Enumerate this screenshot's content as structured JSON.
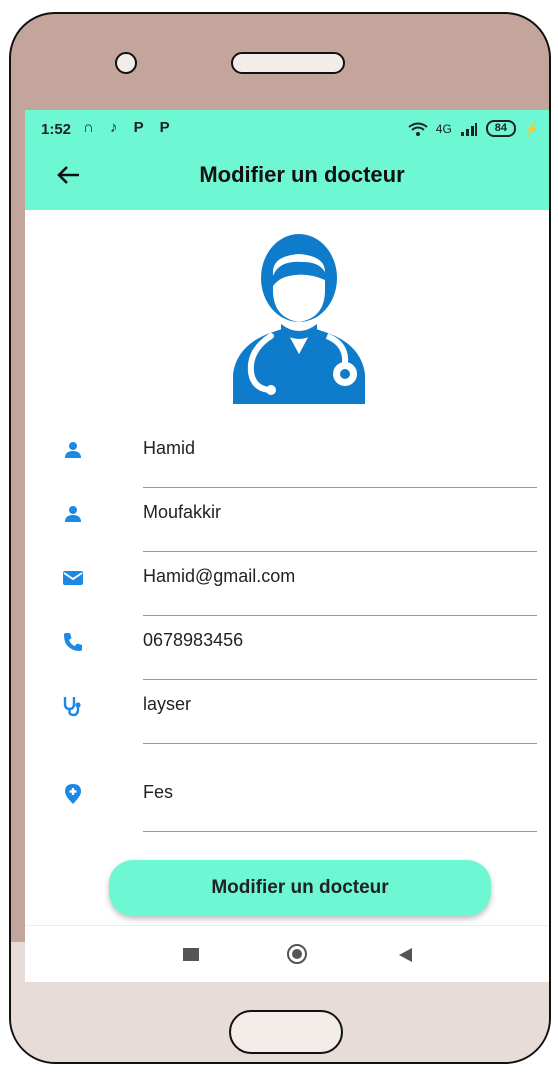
{
  "status_bar": {
    "time": "1:52",
    "left_icons": "∩ ♪ P P",
    "network": "4G",
    "battery": "84",
    "charging": "⚡"
  },
  "header": {
    "title": "Modifier un docteur",
    "back_icon": "arrow-left-icon"
  },
  "avatar": {
    "icon": "doctor-avatar-icon",
    "color": "#0f7ccb"
  },
  "form": {
    "fields": [
      {
        "icon": "person-icon",
        "value": "Hamid"
      },
      {
        "icon": "person-icon",
        "value": "Moufakkir"
      },
      {
        "icon": "mail-icon",
        "value": "Hamid@gmail.com"
      },
      {
        "icon": "phone-icon",
        "value": "0678983456"
      },
      {
        "icon": "stethoscope-icon",
        "value": "layser"
      },
      {
        "icon": "location-pin-icon",
        "value": "Fes"
      }
    ]
  },
  "submit_label": "Modifier un docteur",
  "colors": {
    "accent": "#6df7d3",
    "icon_blue": "#1e88e5",
    "phone_frame": "#c4a59b"
  }
}
